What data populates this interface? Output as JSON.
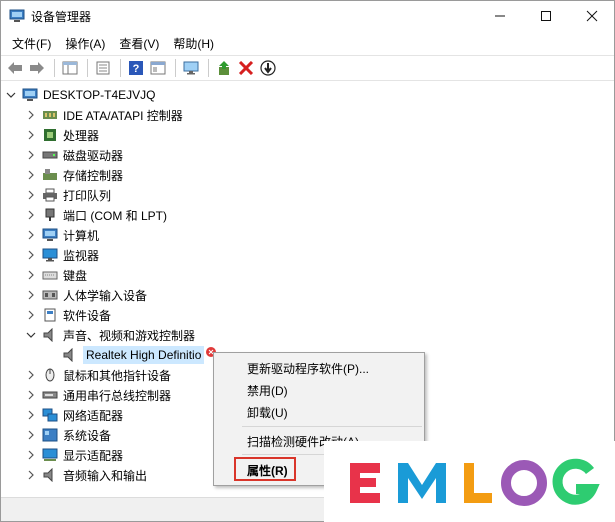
{
  "window": {
    "title": "设备管理器"
  },
  "window_controls": {
    "minimize": "—",
    "maximize": "☐",
    "close": "✕"
  },
  "menu": [
    "文件(F)",
    "操作(A)",
    "查看(V)",
    "帮助(H)"
  ],
  "toolbar": [
    "back-icon",
    "forward-icon",
    "show-hide-icon",
    "properties-icon",
    "help-icon",
    "view-icon",
    "scan-icon",
    "update-driver-icon",
    "uninstall-icon",
    "disable-icon"
  ],
  "tree": {
    "root": "DESKTOP-T4EJVJQ",
    "items": [
      "IDE ATA/ATAPI 控制器",
      "处理器",
      "磁盘驱动器",
      "存储控制器",
      "打印队列",
      "端口 (COM 和 LPT)",
      "计算机",
      "监视器",
      "键盘",
      "人体学输入设备",
      "软件设备",
      "声音、视频和游戏控制器",
      "Realtek High Definition Audio",
      "鼠标和其他指针设备",
      "通用串行总线控制器",
      "网络适配器",
      "系统设备",
      "显示适配器",
      "音频输入和输出"
    ],
    "selected_partial": "Realtek High Definitio"
  },
  "context_menu": {
    "update": "更新驱动程序软件(P)...",
    "disable": "禁用(D)",
    "uninstall": "卸载(U)",
    "scan": "扫描检测硬件改动(A)",
    "properties": "属性(R)"
  },
  "watermark": {
    "letters": [
      "E",
      "M",
      "L",
      "O",
      "G"
    ],
    "colors": [
      "#e8334a",
      "#1a9bd7",
      "#f39c12",
      "#9b59b6",
      "#2ecc71"
    ]
  },
  "colors": {
    "selection": "#cce8ff",
    "highlight_border": "#d9352a",
    "delete_red": "#d61f1f"
  }
}
